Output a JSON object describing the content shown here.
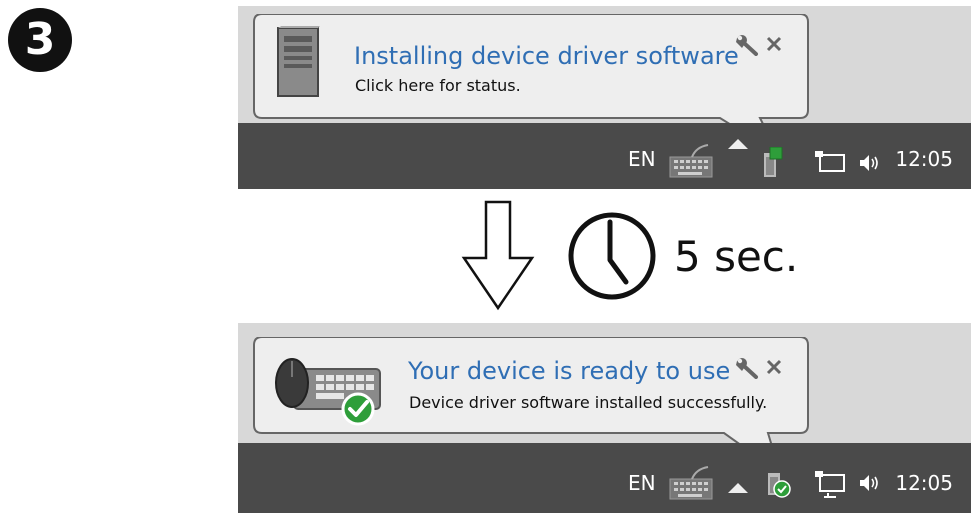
{
  "step": {
    "number": "3"
  },
  "installing": {
    "title": "Installing device driver software",
    "subtitle": "Click here for status.",
    "icon": "computer-tower-icon"
  },
  "ready": {
    "title": "Your device is ready to use",
    "subtitle": "Device driver software installed successfully.",
    "icon": "mouse-keyboard-check-icon"
  },
  "wait": {
    "label": "5 sec."
  },
  "taskbar": {
    "language": "EN",
    "time": "12:05"
  },
  "colors": {
    "title_blue": "#2f6eb4",
    "taskbar": "#4a4a4a",
    "panel": "#d8d8d8",
    "check_green": "#2e9e3a"
  }
}
